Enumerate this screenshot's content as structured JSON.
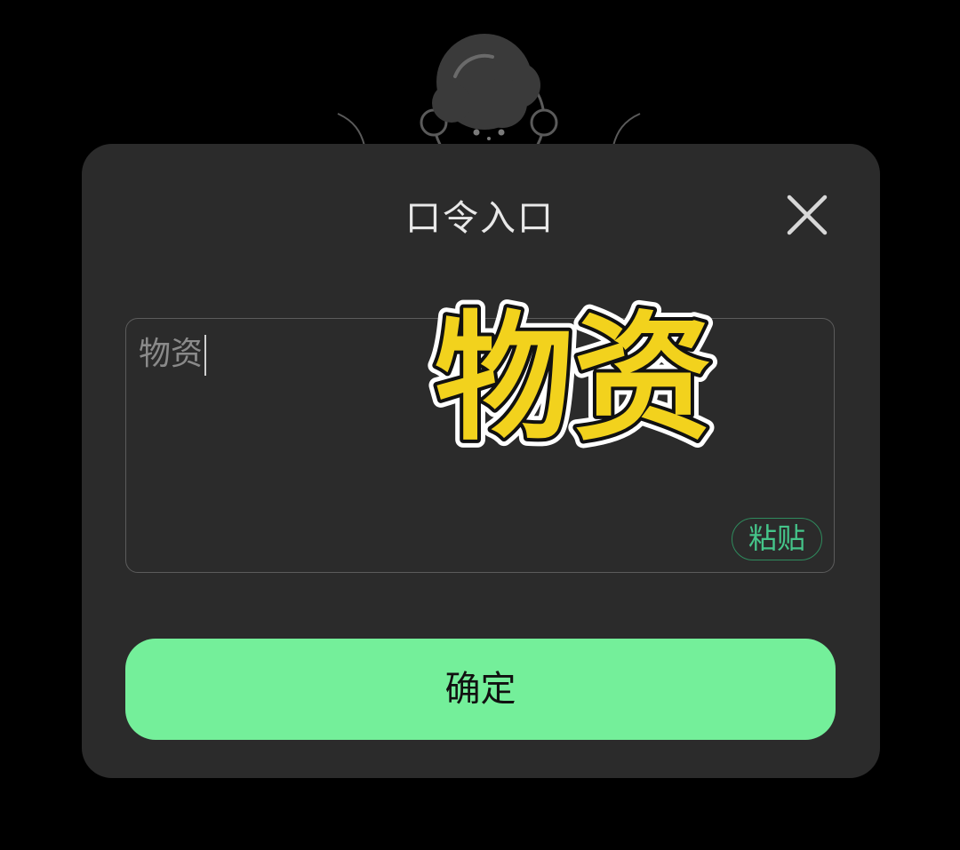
{
  "dialog": {
    "title": "口令入口",
    "close_icon": "close-icon",
    "input": {
      "value": "物资"
    },
    "paste_label": "粘贴",
    "confirm_label": "确定"
  },
  "overlay": {
    "sticker_text": "物资",
    "sticker_fill": "#f2d21d",
    "sticker_outline": "#111111"
  },
  "mascot": {
    "icon": "mascot-icon"
  },
  "colors": {
    "background": "#000000",
    "dialog": "#2b2b2b",
    "accent": "#74ef9a",
    "paste_green": "#45c58a"
  }
}
